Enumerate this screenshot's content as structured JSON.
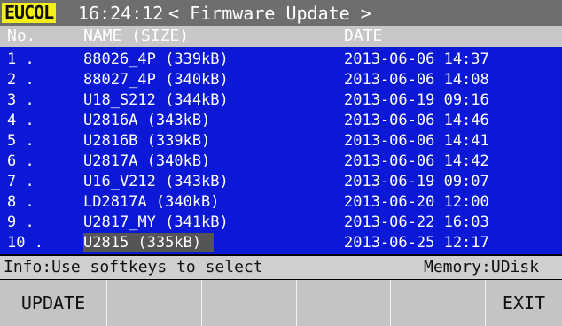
{
  "topbar": {
    "logo": "EUCOL",
    "clock": "16:24:12",
    "title": "< Firmware Update >"
  },
  "table": {
    "headers": {
      "no": "No.",
      "name": "NAME (SIZE)",
      "date": "DATE"
    },
    "rows": [
      {
        "no": "1 .",
        "name": "88026_4P (339kB)",
        "date": "2013-06-06 14:37"
      },
      {
        "no": "2 .",
        "name": "88027_4P (340kB)",
        "date": "2013-06-06 14:08"
      },
      {
        "no": "3 .",
        "name": "U18_S212 (344kB)",
        "date": "2013-06-19 09:16"
      },
      {
        "no": "4 .",
        "name": "U2816A (343kB)",
        "date": "2013-06-06 14:46"
      },
      {
        "no": "5 .",
        "name": "U2816B (339kB)",
        "date": "2013-06-06 14:41"
      },
      {
        "no": "6 .",
        "name": "U2817A (340kB)",
        "date": "2013-06-06 14:42"
      },
      {
        "no": "7 .",
        "name": "U16_V212 (343kB)",
        "date": "2013-06-19 09:07"
      },
      {
        "no": "8 .",
        "name": "LD2817A (340kB)",
        "date": "2013-06-20 12:00"
      },
      {
        "no": "9 .",
        "name": "U2817_MY (341kB)",
        "date": "2013-06-22 16:03"
      },
      {
        "no": "10 .",
        "name": "U2815 (335kB)",
        "date": "2013-06-25 12:17"
      }
    ],
    "selected_index": 9
  },
  "info": {
    "message": "Info:Use softkeys to select",
    "memory": "Memory:UDisk"
  },
  "softkeys": [
    "UPDATE",
    "",
    "",
    "",
    "",
    "EXIT"
  ],
  "colors": {
    "topbar": "#6e6e6e",
    "logo_bg": "#f3ef19",
    "list_bg": "#0b18d6",
    "header_bg": "#c7c7c7",
    "selection_bg": "#555555",
    "softkey_bg": "#c4c4c4"
  }
}
